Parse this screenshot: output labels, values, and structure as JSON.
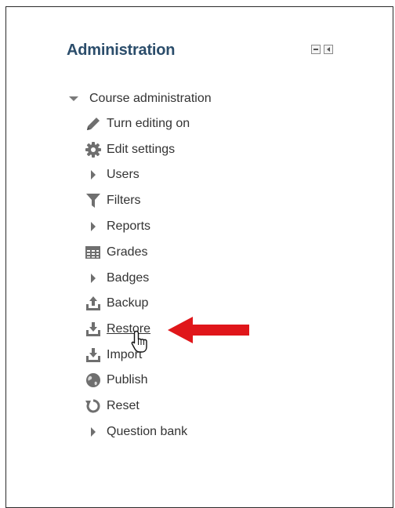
{
  "block": {
    "title": "Administration",
    "controls": [
      {
        "name": "dock-block-icon"
      },
      {
        "name": "hide-block-icon"
      }
    ]
  },
  "tree": {
    "root_label": "Course administration",
    "items": [
      {
        "label": "Turn editing on",
        "icon": "pencil-icon",
        "type": "action"
      },
      {
        "label": "Edit settings",
        "icon": "gear-icon",
        "type": "action"
      },
      {
        "label": "Users",
        "icon": "caret-right-icon",
        "type": "branch"
      },
      {
        "label": "Filters",
        "icon": "filter-icon",
        "type": "action"
      },
      {
        "label": "Reports",
        "icon": "caret-right-icon",
        "type": "branch"
      },
      {
        "label": "Grades",
        "icon": "table-icon",
        "type": "action"
      },
      {
        "label": "Badges",
        "icon": "caret-right-icon",
        "type": "branch"
      },
      {
        "label": "Backup",
        "icon": "upload-icon",
        "type": "action"
      },
      {
        "label": "Restore",
        "icon": "download-icon",
        "type": "action",
        "hovered": true
      },
      {
        "label": "Import",
        "icon": "download-icon",
        "type": "action"
      },
      {
        "label": "Publish",
        "icon": "globe-icon",
        "type": "action"
      },
      {
        "label": "Reset",
        "icon": "refresh-icon",
        "type": "action"
      },
      {
        "label": "Question bank",
        "icon": "caret-right-icon",
        "type": "branch"
      }
    ]
  },
  "annotation": {
    "arrow_color": "#e0161a",
    "points_to": "Restore"
  },
  "colors": {
    "title": "#2b4d6b",
    "text": "#333333",
    "icon": "#6f6f6f"
  }
}
